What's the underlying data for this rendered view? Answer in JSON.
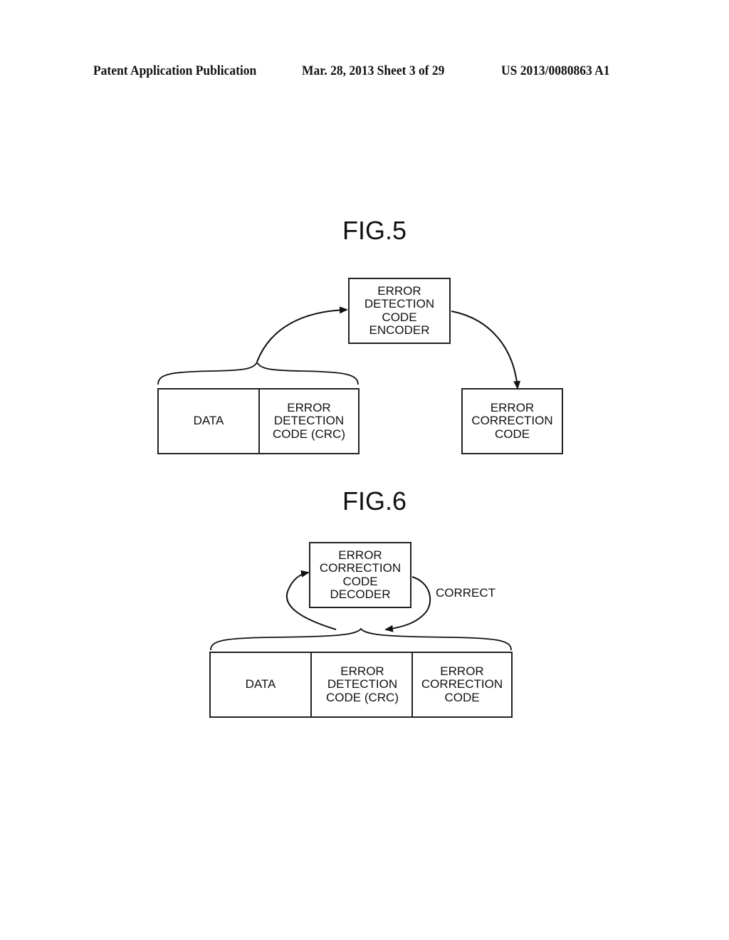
{
  "header": {
    "left": "Patent Application Publication",
    "center": "Mar. 28, 2013  Sheet 3 of 29",
    "right": "US 2013/0080863 A1"
  },
  "fig5": {
    "title": "FIG.5",
    "encoder_box": "ERROR\nDETECTION\nCODE\nENCODER",
    "frame": {
      "data": "DATA",
      "edc": "ERROR\nDETECTION\nCODE (CRC)"
    },
    "output_box": "ERROR\nCORRECTION\nCODE"
  },
  "fig6": {
    "title": "FIG.6",
    "decoder_box": "ERROR\nCORRECTION\nCODE\nDECODER",
    "correct_label": "CORRECT",
    "frame": {
      "data": "DATA",
      "edc": "ERROR\nDETECTION\nCODE (CRC)",
      "ecc": "ERROR\nCORRECTION\nCODE"
    }
  }
}
